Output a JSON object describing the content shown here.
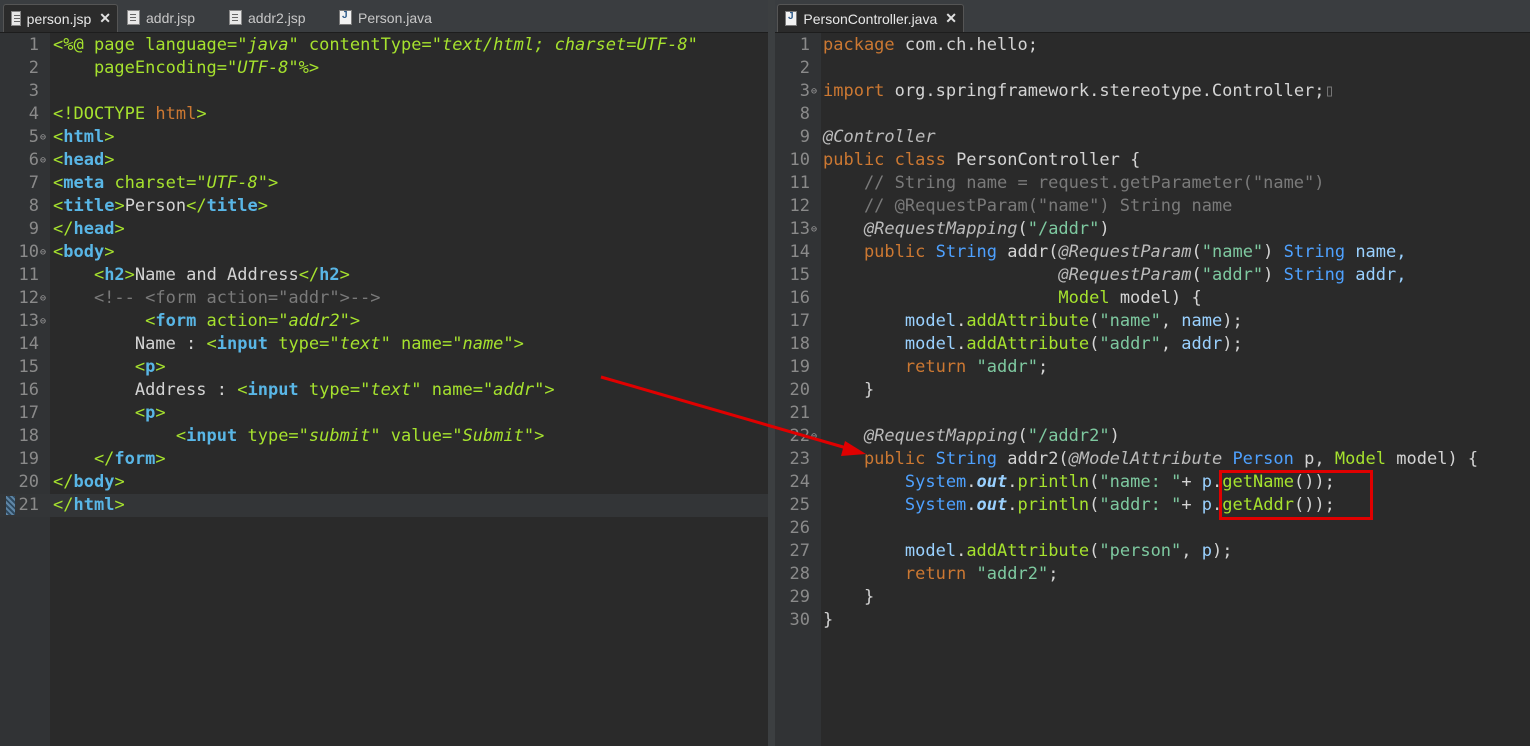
{
  "left_tabs": [
    {
      "label": "person.jsp",
      "active": true,
      "icon": "jsp-file-icon",
      "closable": true
    },
    {
      "label": "addr.jsp",
      "active": false,
      "icon": "jsp-file-icon"
    },
    {
      "label": "addr2.jsp",
      "active": false,
      "icon": "jsp-file-icon"
    },
    {
      "label": "Person.java",
      "active": false,
      "icon": "java-file-icon"
    }
  ],
  "right_tabs": [
    {
      "label": "PersonController.java",
      "active": true,
      "icon": "java-file-icon",
      "closable": true
    }
  ],
  "close_glyph": "✕",
  "left_lines": [
    {
      "n": "1",
      "fold": false,
      "segs": [
        [
          "<%@ ",
          "attr"
        ],
        [
          "page ",
          "attr"
        ],
        [
          "language=",
          "attr"
        ],
        [
          "\"java\"",
          "str"
        ],
        [
          " contentType=",
          "attr"
        ],
        [
          "\"text/html; charset=UTF-8\"",
          "str"
        ]
      ]
    },
    {
      "n": "2",
      "fold": false,
      "segs": [
        [
          "    pageEncoding=",
          "attr"
        ],
        [
          "\"UTF-8\"",
          "str"
        ],
        [
          "%>",
          "attr"
        ]
      ]
    },
    {
      "n": "3",
      "fold": false,
      "segs": []
    },
    {
      "n": "4",
      "fold": false,
      "segs": [
        [
          "<!DOCTYPE ",
          "attr"
        ],
        [
          "html",
          "kw"
        ],
        [
          ">",
          "attr"
        ]
      ]
    },
    {
      "n": "5",
      "fold": true,
      "segs": [
        [
          "<",
          "attr"
        ],
        [
          "html",
          "tag"
        ],
        [
          ">",
          "attr"
        ]
      ]
    },
    {
      "n": "6",
      "fold": true,
      "segs": [
        [
          "<",
          "attr"
        ],
        [
          "head",
          "tag"
        ],
        [
          ">",
          "attr"
        ]
      ]
    },
    {
      "n": "7",
      "fold": false,
      "segs": [
        [
          "<",
          "attr"
        ],
        [
          "meta",
          "tag"
        ],
        [
          " charset=",
          "attr"
        ],
        [
          "\"UTF-8\"",
          "str"
        ],
        [
          ">",
          "attr"
        ]
      ]
    },
    {
      "n": "8",
      "fold": false,
      "segs": [
        [
          "<",
          "attr"
        ],
        [
          "title",
          "tag"
        ],
        [
          ">",
          "attr"
        ],
        [
          "Person",
          ""
        ],
        [
          "</",
          "attr"
        ],
        [
          "title",
          "tag"
        ],
        [
          ">",
          "attr"
        ]
      ]
    },
    {
      "n": "9",
      "fold": false,
      "segs": [
        [
          "</",
          "attr"
        ],
        [
          "head",
          "tag"
        ],
        [
          ">",
          "attr"
        ]
      ]
    },
    {
      "n": "10",
      "fold": true,
      "segs": [
        [
          "<",
          "attr"
        ],
        [
          "body",
          "tag"
        ],
        [
          ">",
          "attr"
        ]
      ]
    },
    {
      "n": "11",
      "fold": false,
      "segs": [
        [
          "    <",
          "attr"
        ],
        [
          "h2",
          "tag"
        ],
        [
          ">",
          "attr"
        ],
        [
          "Name and Address",
          ""
        ],
        [
          "</",
          "attr"
        ],
        [
          "h2",
          "tag"
        ],
        [
          ">",
          "attr"
        ]
      ]
    },
    {
      "n": "12",
      "fold": true,
      "segs": [
        [
          "    <!-- <form action=\"addr\">-->",
          "cmt"
        ]
      ]
    },
    {
      "n": "13",
      "fold": true,
      "segs": [
        [
          "         <",
          "attr"
        ],
        [
          "form",
          "tag"
        ],
        [
          " action=",
          "attr"
        ],
        [
          "\"addr2\"",
          "str"
        ],
        [
          ">",
          "attr"
        ]
      ]
    },
    {
      "n": "14",
      "fold": false,
      "segs": [
        [
          "        Name : ",
          ""
        ],
        [
          "<",
          "attr"
        ],
        [
          "input",
          "tag"
        ],
        [
          " type=",
          "attr"
        ],
        [
          "\"text\"",
          "str"
        ],
        [
          " name=",
          "attr"
        ],
        [
          "\"name\"",
          "str"
        ],
        [
          ">",
          "attr"
        ]
      ]
    },
    {
      "n": "15",
      "fold": false,
      "segs": [
        [
          "        <",
          "attr"
        ],
        [
          "p",
          "tag"
        ],
        [
          ">",
          "attr"
        ]
      ]
    },
    {
      "n": "16",
      "fold": false,
      "segs": [
        [
          "        Address : ",
          ""
        ],
        [
          "<",
          "attr"
        ],
        [
          "input",
          "tag"
        ],
        [
          " type=",
          "attr"
        ],
        [
          "\"text\"",
          "str"
        ],
        [
          " name=",
          "attr"
        ],
        [
          "\"addr\"",
          "str"
        ],
        [
          ">",
          "attr"
        ]
      ]
    },
    {
      "n": "17",
      "fold": false,
      "segs": [
        [
          "        <",
          "attr"
        ],
        [
          "p",
          "tag"
        ],
        [
          ">",
          "attr"
        ]
      ]
    },
    {
      "n": "18",
      "fold": false,
      "segs": [
        [
          "            <",
          "attr"
        ],
        [
          "input",
          "tag"
        ],
        [
          " type=",
          "attr"
        ],
        [
          "\"submit\"",
          "str"
        ],
        [
          " value=",
          "attr"
        ],
        [
          "\"Submit\"",
          "str"
        ],
        [
          ">",
          "attr"
        ]
      ]
    },
    {
      "n": "19",
      "fold": false,
      "segs": [
        [
          "    </",
          "attr"
        ],
        [
          "form",
          "tag"
        ],
        [
          ">",
          "attr"
        ]
      ]
    },
    {
      "n": "20",
      "fold": false,
      "segs": [
        [
          "</",
          "attr"
        ],
        [
          "body",
          "tag"
        ],
        [
          ">",
          "attr"
        ]
      ]
    },
    {
      "n": "21",
      "fold": false,
      "current": true,
      "segs": [
        [
          "</",
          "attr"
        ],
        [
          "html",
          "tag"
        ],
        [
          ">",
          "attr"
        ]
      ]
    }
  ],
  "right_lines": [
    {
      "n": "1",
      "fold": false,
      "segs": [
        [
          "package ",
          "kw"
        ],
        [
          "com.ch.hello;",
          ""
        ]
      ]
    },
    {
      "n": "2",
      "fold": false,
      "segs": []
    },
    {
      "n": "3",
      "fold": true,
      "segs": [
        [
          "import ",
          "kw"
        ],
        [
          "org.springframework.stereotype.Controller;",
          ""
        ],
        [
          "▯",
          "cmt"
        ]
      ]
    },
    {
      "n": "8",
      "fold": false,
      "segs": []
    },
    {
      "n": "9",
      "fold": false,
      "segs": [
        [
          "@Controller",
          "ann"
        ]
      ]
    },
    {
      "n": "10",
      "fold": false,
      "segs": [
        [
          "public class ",
          "kw"
        ],
        [
          "PersonController",
          ""
        ],
        [
          " {",
          ""
        ]
      ]
    },
    {
      "n": "11",
      "fold": false,
      "segs": [
        [
          "    // String name = request.getParameter(\"name\")",
          "cmt"
        ]
      ]
    },
    {
      "n": "12",
      "fold": false,
      "segs": [
        [
          "    // @RequestParam(\"name\") String name",
          "cmt"
        ]
      ]
    },
    {
      "n": "13",
      "fold": true,
      "segs": [
        [
          "    @RequestMapping",
          "ann"
        ],
        [
          "(",
          ""
        ],
        [
          "\"/addr\"",
          "jstr"
        ],
        [
          ")",
          ""
        ]
      ]
    },
    {
      "n": "14",
      "fold": false,
      "segs": [
        [
          "    public ",
          "kw"
        ],
        [
          "String",
          "type"
        ],
        [
          " addr(",
          ""
        ],
        [
          "@RequestParam",
          "ann"
        ],
        [
          "(",
          ""
        ],
        [
          "\"name\"",
          "jstr"
        ],
        [
          ") ",
          ""
        ],
        [
          "String",
          "type"
        ],
        [
          " name,",
          "fld"
        ]
      ]
    },
    {
      "n": "15",
      "fold": false,
      "segs": [
        [
          "                       @RequestParam",
          "ann"
        ],
        [
          "(",
          ""
        ],
        [
          "\"addr\"",
          "jstr"
        ],
        [
          ") ",
          ""
        ],
        [
          "String",
          "type"
        ],
        [
          " addr,",
          "fld"
        ]
      ]
    },
    {
      "n": "16",
      "fold": false,
      "segs": [
        [
          "                       Model",
          "meth"
        ],
        [
          " model",
          ""
        ],
        [
          ") {",
          ""
        ]
      ]
    },
    {
      "n": "17",
      "fold": false,
      "segs": [
        [
          "        model",
          "fld"
        ],
        [
          ".",
          ""
        ],
        [
          "addAttribute",
          "meth"
        ],
        [
          "(",
          ""
        ],
        [
          "\"name\"",
          "jstr"
        ],
        [
          ", ",
          ""
        ],
        [
          "name",
          "fld"
        ],
        [
          ");",
          ""
        ]
      ]
    },
    {
      "n": "18",
      "fold": false,
      "segs": [
        [
          "        model",
          "fld"
        ],
        [
          ".",
          ""
        ],
        [
          "addAttribute",
          "meth"
        ],
        [
          "(",
          ""
        ],
        [
          "\"addr\"",
          "jstr"
        ],
        [
          ", ",
          ""
        ],
        [
          "addr",
          "fld"
        ],
        [
          ");",
          ""
        ]
      ]
    },
    {
      "n": "19",
      "fold": false,
      "segs": [
        [
          "        return ",
          "kw"
        ],
        [
          "\"addr\"",
          "jstr"
        ],
        [
          ";",
          ""
        ]
      ]
    },
    {
      "n": "20",
      "fold": false,
      "segs": [
        [
          "    }",
          ""
        ]
      ]
    },
    {
      "n": "21",
      "fold": false,
      "segs": []
    },
    {
      "n": "22",
      "fold": true,
      "segs": [
        [
          "    @RequestMapping",
          "ann"
        ],
        [
          "(",
          ""
        ],
        [
          "\"/addr2\"",
          "jstr"
        ],
        [
          ")",
          ""
        ]
      ]
    },
    {
      "n": "23",
      "fold": false,
      "segs": [
        [
          "    public ",
          "kw"
        ],
        [
          "String",
          "type"
        ],
        [
          " addr2(",
          ""
        ],
        [
          "@ModelAttribute",
          "ann"
        ],
        [
          " Person",
          "type"
        ],
        [
          " p",
          ""
        ],
        [
          ", ",
          ""
        ],
        [
          "Model",
          "meth"
        ],
        [
          " model",
          ""
        ],
        [
          ") {",
          ""
        ]
      ]
    },
    {
      "n": "24",
      "fold": false,
      "segs": [
        [
          "        System",
          "type"
        ],
        [
          ".",
          ""
        ],
        [
          "out",
          "fld bold ital"
        ],
        [
          ".",
          ""
        ],
        [
          "println",
          "meth"
        ],
        [
          "(",
          ""
        ],
        [
          "\"name: \"",
          "jstr"
        ],
        [
          "+ ",
          ""
        ],
        [
          "p",
          "fld"
        ],
        [
          ".",
          ""
        ],
        [
          "getName",
          "meth"
        ],
        [
          "());",
          ""
        ]
      ]
    },
    {
      "n": "25",
      "fold": false,
      "segs": [
        [
          "        System",
          "type"
        ],
        [
          ".",
          ""
        ],
        [
          "out",
          "fld bold ital"
        ],
        [
          ".",
          ""
        ],
        [
          "println",
          "meth"
        ],
        [
          "(",
          ""
        ],
        [
          "\"addr: \"",
          "jstr"
        ],
        [
          "+ ",
          ""
        ],
        [
          "p",
          "fld"
        ],
        [
          ".",
          ""
        ],
        [
          "getAddr",
          "meth"
        ],
        [
          "());",
          ""
        ]
      ]
    },
    {
      "n": "26",
      "fold": false,
      "segs": []
    },
    {
      "n": "27",
      "fold": false,
      "segs": [
        [
          "        model",
          "fld"
        ],
        [
          ".",
          ""
        ],
        [
          "addAttribute",
          "meth"
        ],
        [
          "(",
          ""
        ],
        [
          "\"person\"",
          "jstr"
        ],
        [
          ", ",
          ""
        ],
        [
          "p",
          "fld"
        ],
        [
          ");",
          ""
        ]
      ]
    },
    {
      "n": "28",
      "fold": false,
      "segs": [
        [
          "        return ",
          "kw"
        ],
        [
          "\"addr2\"",
          "jstr"
        ],
        [
          ";",
          ""
        ]
      ]
    },
    {
      "n": "29",
      "fold": false,
      "segs": [
        [
          "    }",
          ""
        ]
      ]
    },
    {
      "n": "30",
      "fold": false,
      "segs": [
        [
          "}",
          ""
        ]
      ]
    }
  ],
  "colors": {
    "arrow": "#e00000",
    "highlight_box": "#e00000"
  }
}
